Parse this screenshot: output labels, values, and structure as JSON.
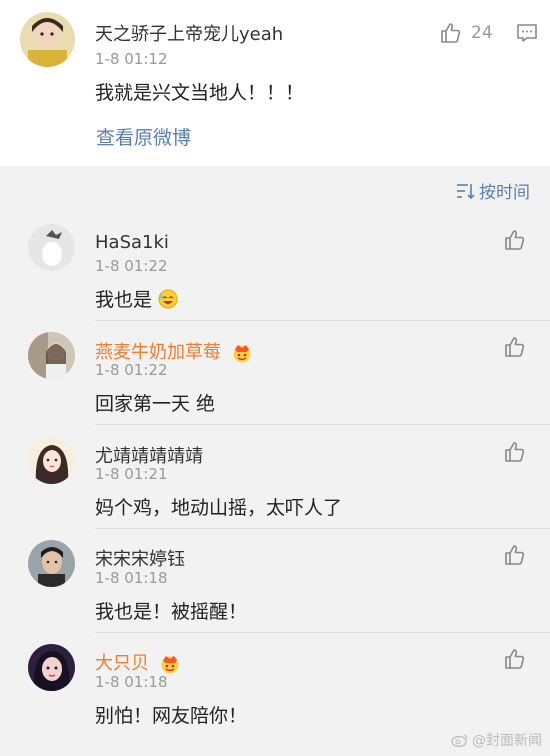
{
  "post": {
    "user": "天之骄子上帝宠儿yeah",
    "time": "1-8 01:12",
    "text": "我就是兴文当地人！！！",
    "likes": "24",
    "view_original": "查看原微博"
  },
  "sort_label": "按时间",
  "comments": [
    {
      "name": "HaSa1ki",
      "time": "1-8 01:22",
      "text": "我也是",
      "vip": false
    },
    {
      "name": "燕麦牛奶加草莓",
      "time": "1-8 01:22",
      "text": "回家第一天 绝",
      "vip": true
    },
    {
      "name": "尤靖靖靖靖靖",
      "time": "1-8 01:21",
      "text": "妈个鸡，地动山摇，太吓人了",
      "vip": false
    },
    {
      "name": "宋宋宋婷钰",
      "time": "1-8 01:18",
      "text": "我也是！被摇醒！",
      "vip": false
    },
    {
      "name": "大只贝",
      "time": "1-8 01:18",
      "text": "别怕！网友陪你！",
      "vip": true
    }
  ],
  "watermark": "@封面新闻",
  "icons": {
    "like": "thumbs-up-icon",
    "comment": "comment-icon",
    "sort": "sort-icon",
    "vip": "vip-crown-icon",
    "laugh": "laughing-emoji-icon"
  },
  "colors": {
    "link": "#5b7fae",
    "vip_name": "#f27c2c",
    "meta": "#999999"
  }
}
